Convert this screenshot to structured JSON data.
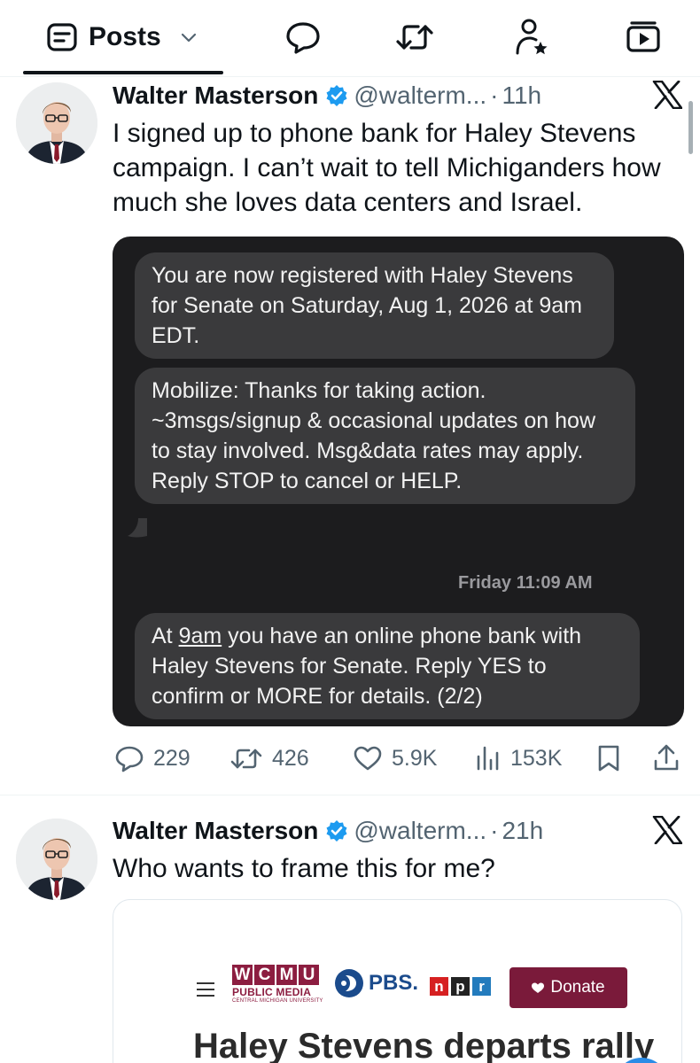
{
  "topbar": {
    "tabs": [
      {
        "label": "Posts",
        "icon": "posts-icon",
        "selected": true
      },
      {
        "icon": "chat-bubble-icon"
      },
      {
        "icon": "retweet-icon"
      },
      {
        "icon": "person-star-icon"
      },
      {
        "icon": "video-icon"
      }
    ]
  },
  "posts": [
    {
      "author": "Walter Masterson",
      "verified": true,
      "handle": "@walterm...",
      "separator": "·",
      "time": "11h",
      "text": "I signed up to phone bank for Haley Stevens campaign. I can’t wait to tell Michiganders how much she loves data centers and Israel.",
      "media": {
        "messages": [
          {
            "text": "You are now registered with Haley Stevens for Senate on Saturday, Aug 1, 2026 at 9am EDT."
          },
          {
            "text": "Mobilize: Thanks for taking action. ~3msgs/signup & occasional updates on how to stay involved. Msg&data rates may apply. Reply STOP to cancel or HELP."
          },
          {
            "timestamp": "Friday 11:09 AM"
          },
          {
            "prefix": "At ",
            "link": "9am",
            "text": " you have an online phone bank with Haley Stevens for Senate. Reply YES to confirm or MORE for details. (2/2)"
          }
        ]
      },
      "stats": {
        "replies": "229",
        "reposts": "426",
        "likes": "5.9K",
        "views": "153K"
      }
    },
    {
      "author": "Walter Masterson",
      "verified": true,
      "handle": "@walterm...",
      "separator": "·",
      "time": "21h",
      "text": "Who wants to frame this for me?",
      "card": {
        "logo_letters": [
          "W",
          "C",
          "M",
          "U"
        ],
        "logo_sub": "PUBLIC MEDIA",
        "logo_sub2": "CENTRAL MICHIGAN UNIVERSITY",
        "pbs": "PBS.",
        "npr": [
          "n",
          "p",
          "r"
        ],
        "donate": "Donate",
        "headline": "Haley Stevens departs rally"
      }
    }
  ],
  "colors": {
    "verified": "#1d9bf0",
    "text": "#0f1419",
    "muted": "#536471",
    "bubble": "#3a3a3c",
    "donate": "#7a1a3a"
  }
}
